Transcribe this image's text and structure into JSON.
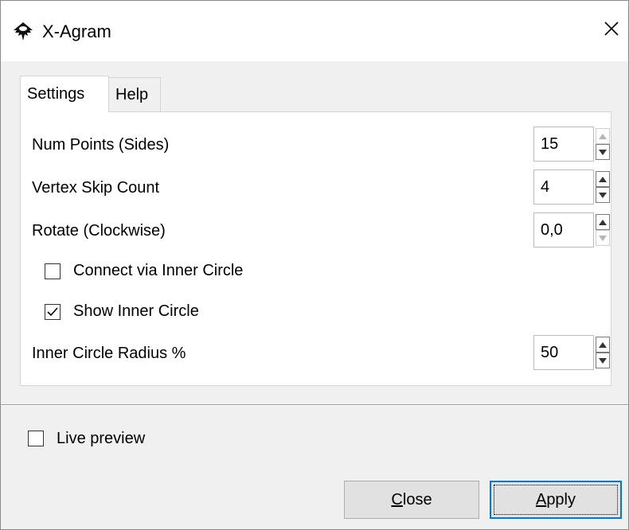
{
  "window": {
    "title": "X-Agram",
    "app_icon": "inkscape-icon",
    "close_icon": "close-icon"
  },
  "tabs": [
    {
      "label": "Settings",
      "active": true
    },
    {
      "label": "Help",
      "active": false
    }
  ],
  "settings": {
    "num_points": {
      "label": "Num Points (Sides)",
      "value": "15"
    },
    "vertex_skip": {
      "label": "Vertex Skip Count",
      "value": "4"
    },
    "rotate": {
      "label": "Rotate (Clockwise)",
      "value": "0,0"
    },
    "connect_inner": {
      "label": "Connect via Inner Circle",
      "checked": false
    },
    "show_inner": {
      "label": "Show Inner Circle",
      "checked": true
    },
    "inner_radius": {
      "label": "Inner Circle Radius %",
      "value": "50"
    }
  },
  "live_preview": {
    "label": "Live preview",
    "checked": false
  },
  "buttons": {
    "close": {
      "mnemonic": "C",
      "rest": "lose"
    },
    "apply": {
      "mnemonic": "A",
      "rest": "pply"
    }
  },
  "colors": {
    "accent": "#0078d7",
    "window_bg": "#f0f0f0"
  }
}
